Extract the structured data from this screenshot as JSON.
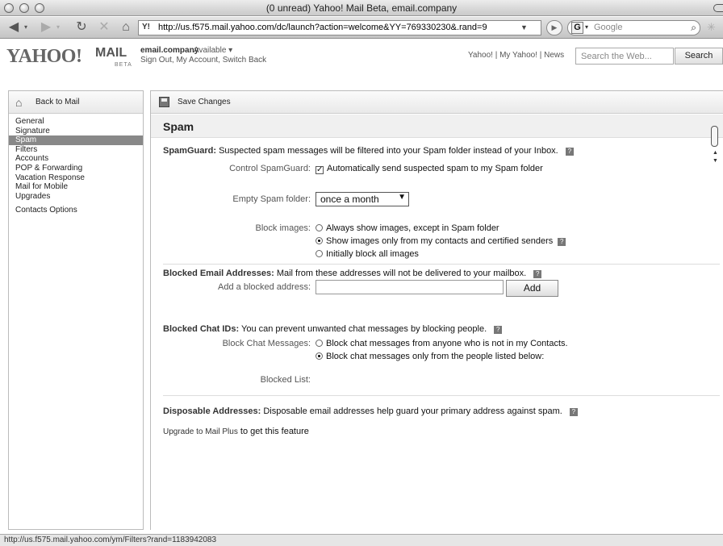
{
  "window": {
    "title": "(0 unread) Yahoo! Mail Beta, email.company"
  },
  "browser": {
    "url": "http://us.f575.mail.yahoo.com/dc/launch?action=welcome&YY=769330230&.rand=9",
    "search_placeholder": "Google",
    "search_engine_letter": "G"
  },
  "header": {
    "logo": "YAHOO!",
    "logo_product": "MAIL",
    "logo_badge": "BETA",
    "account_name": "email.company",
    "account_status": "Available ▾",
    "account_links": "Sign Out, My Account, Switch Back",
    "top_links": "Yahoo! | My Yahoo! | News",
    "search_placeholder": "Search the Web...",
    "search_button": "Search"
  },
  "sidebar": {
    "back_label": "Back to Mail",
    "items": [
      "General",
      "Signature",
      "Spam",
      "Filters",
      "Accounts",
      "POP & Forwarding",
      "Vacation Response",
      "Mail for Mobile",
      "Upgrades",
      "Contacts Options"
    ],
    "selected": "Spam"
  },
  "toolbar": {
    "save_label": "Save Changes"
  },
  "page": {
    "title": "Spam"
  },
  "spamguard": {
    "title": "SpamGuard:",
    "desc": "Suspected spam messages will be filtered into your Spam folder instead of your Inbox.",
    "control_label": "Control SpamGuard:",
    "control_checkbox": "Automatically send suspected spam to my Spam folder",
    "empty_label": "Empty Spam folder:",
    "empty_value": "once a month",
    "block_images_label": "Block images:",
    "block_images_options": [
      "Always show images, except in Spam folder",
      "Show images only from my contacts and certified senders",
      "Initially block all images"
    ],
    "block_images_selected": 1
  },
  "blocked_email": {
    "title": "Blocked Email Addresses:",
    "desc": "Mail from these addresses will not be delivered to your mailbox.",
    "add_label": "Add a blocked address:",
    "add_button": "Add"
  },
  "blocked_chat": {
    "title": "Blocked Chat IDs:",
    "desc": "You can prevent unwanted chat messages by blocking people.",
    "messages_label": "Block Chat Messages:",
    "options": [
      "Block chat messages from anyone who is not in my Contacts.",
      "Block chat messages only from the people listed below:"
    ],
    "selected": 1,
    "list_label": "Blocked List:"
  },
  "disposable": {
    "title": "Disposable Addresses:",
    "desc": "Disposable email addresses help guard your primary address against spam.",
    "upgrade_link": "Upgrade to Mail Plus",
    "upgrade_suffix": "to get this feature"
  },
  "status": {
    "text": "http://us.f575.mail.yahoo.com/ym/Filters?rand=1183942083"
  }
}
